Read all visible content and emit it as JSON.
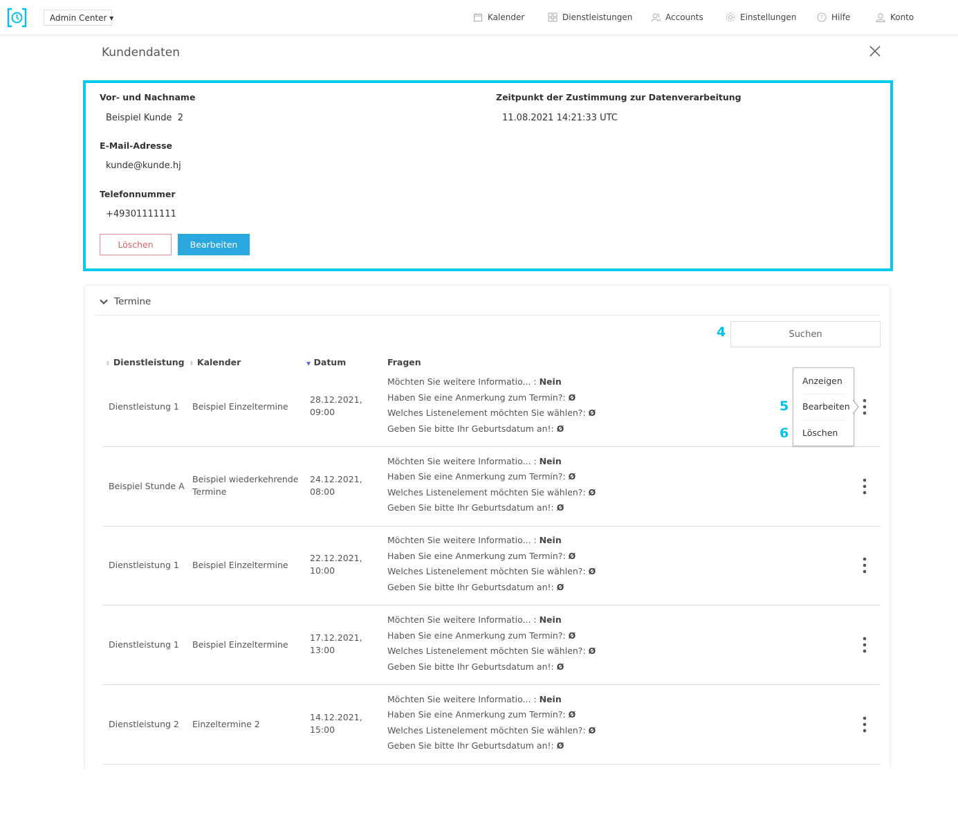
{
  "header": {
    "app_switcher": "Admin Center",
    "nav": [
      {
        "label": "Kalender",
        "icon": "calendar-icon"
      },
      {
        "label": "Dienstleistungen",
        "icon": "grid-icon"
      },
      {
        "label": "Accounts",
        "icon": "users-icon"
      },
      {
        "label": "Einstellungen",
        "icon": "gear-icon"
      },
      {
        "label": "Hilfe",
        "icon": "help-icon"
      },
      {
        "label": "Konto",
        "icon": "user-icon"
      }
    ]
  },
  "page": {
    "title": "Kundendaten"
  },
  "customer": {
    "name_label": "Vor- und Nachname",
    "name": "Beispiel Kunde  2",
    "email_label": "E-Mail-Adresse",
    "email": "kunde@kunde.hj",
    "phone_label": "Telefonnummer",
    "phone": "+49301111111",
    "consent_label": "Zeitpunkt der Zustimmung zur Datenverarbeitung",
    "consent": "11.08.2021 14:21:33 UTC",
    "delete_label": "Löschen",
    "edit_label": "Bearbeiten"
  },
  "appointments": {
    "section_title": "Termine",
    "search_label": "Suchen",
    "columns": [
      "Dienstleistung",
      "Kalender",
      "Datum",
      "Fragen"
    ],
    "rows": [
      {
        "service": "Dienstleistung 1",
        "calendar": "Beispiel Einzeltermine",
        "date": "28.12.2021,",
        "time": "09:00"
      },
      {
        "service": "Beispiel Stunde A",
        "calendar": "Beispiel wiederkehrende Termine",
        "date": "24.12.2021,",
        "time": "08:00"
      },
      {
        "service": "Dienstleistung 1",
        "calendar": "Beispiel Einzeltermine",
        "date": "22.12.2021,",
        "time": "10:00"
      },
      {
        "service": "Dienstleistung 1",
        "calendar": "Beispiel Einzeltermine",
        "date": "17.12.2021,",
        "time": "13:00"
      },
      {
        "service": "Dienstleistung 2",
        "calendar": "Einzeltermine 2",
        "date": "14.12.2021,",
        "time": "15:00"
      }
    ],
    "questions": [
      {
        "q": "Möchten Sie weitere Informatio... : ",
        "a": "Nein"
      },
      {
        "q": "Haben Sie eine Anmerkung zum Termin?: ",
        "a": "Ø"
      },
      {
        "q": "Welches Listenelement möchten Sie wählen?: ",
        "a": "Ø"
      },
      {
        "q": "Geben Sie bitte Ihr Geburtsdatum an!: ",
        "a": "Ø"
      }
    ],
    "row_menu": [
      "Anzeigen",
      "Bearbeiten",
      "Löschen"
    ]
  },
  "annotations": [
    "4",
    "5",
    "6"
  ],
  "colors": {
    "accent": "#00c8f0",
    "primary_button": "#29a8e0",
    "danger": "#e0606c"
  }
}
